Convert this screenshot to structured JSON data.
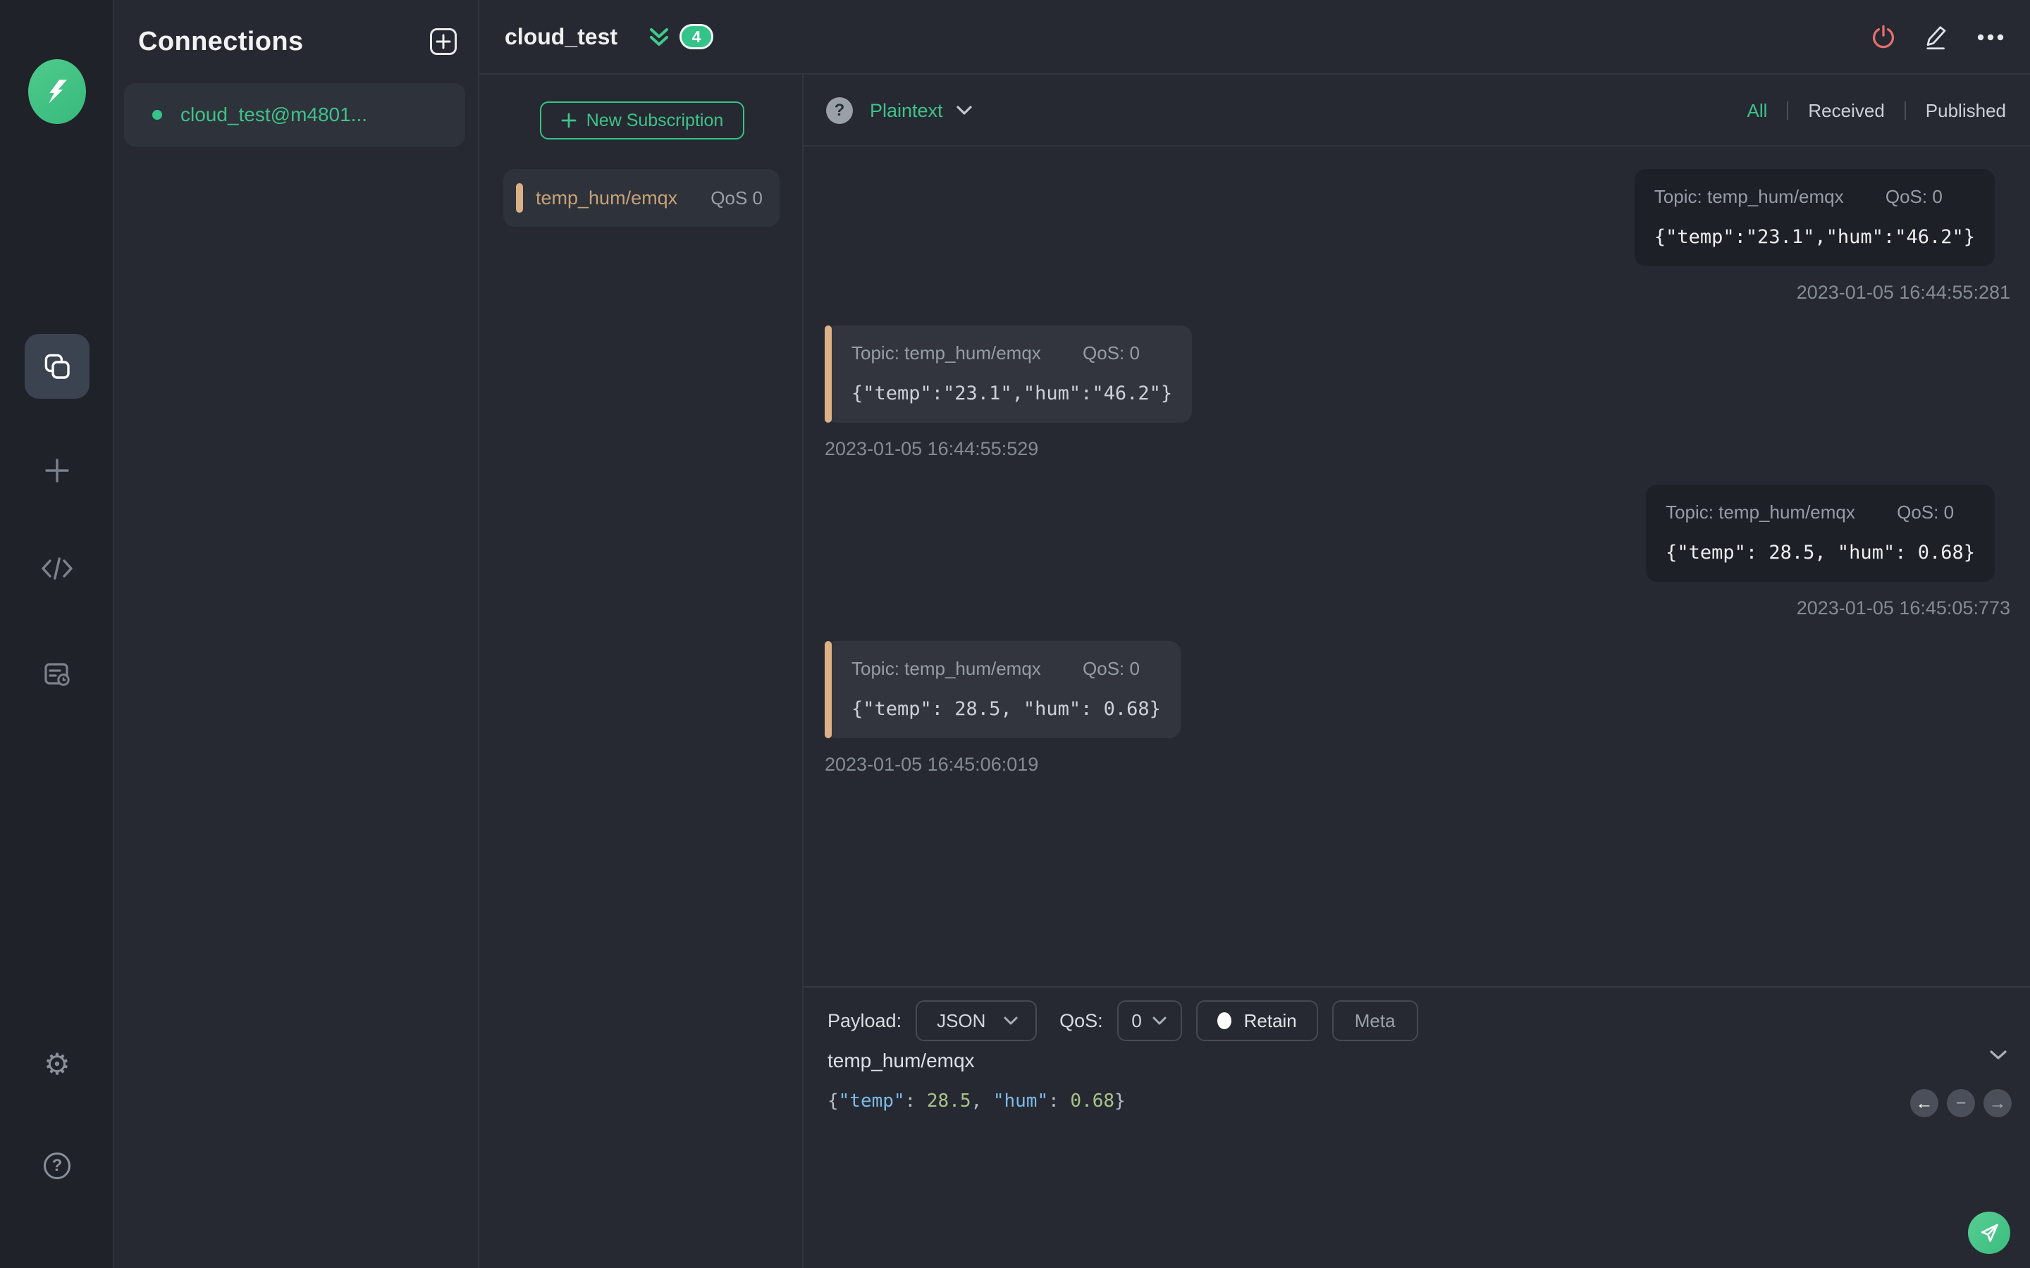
{
  "app": {
    "accent_green": "#34c388",
    "accent_tan": "#d0a97e",
    "danger_red": "#e36f6f",
    "syntax": {
      "key": "#7db9e8",
      "number": "#a9c289",
      "punctuation": "#b6bcc4"
    }
  },
  "glyphs": {
    "help": "?",
    "gear": "⚙",
    "prev_arrow": "←",
    "collapse_minus": "−",
    "next_arrow": "→"
  },
  "connections": {
    "title": "Connections",
    "items": [
      {
        "name": "cloud_test@m4801...",
        "selected": true,
        "status_color": "#34c388"
      }
    ]
  },
  "subscriptions": {
    "connection_name": "cloud_test",
    "badge_count": "4",
    "new_subscription_label": "New Subscription",
    "items": [
      {
        "topic": "temp_hum/emqx",
        "qos": "QoS 0"
      }
    ]
  },
  "toolbar": {
    "format": "Plaintext",
    "filters": {
      "all": "All",
      "received": "Received",
      "published": "Published"
    }
  },
  "messages": [
    {
      "type": "published",
      "meta_topic": "Topic: temp_hum/emqx",
      "meta_qos": "QoS: 0",
      "payload": "{\"temp\":\"23.1\",\"hum\":\"46.2\"}",
      "time": "2023-01-05 16:44:55:281"
    },
    {
      "type": "received",
      "meta_topic": "Topic: temp_hum/emqx",
      "meta_qos": "QoS: 0",
      "payload": "{\"temp\":\"23.1\",\"hum\":\"46.2\"}",
      "time": "2023-01-05 16:44:55:529"
    },
    {
      "type": "published",
      "meta_topic": "Topic: temp_hum/emqx",
      "meta_qos": "QoS: 0",
      "payload": "{\"temp\": 28.5, \"hum\": 0.68}",
      "time": "2023-01-05 16:45:05:773"
    },
    {
      "type": "received",
      "meta_topic": "Topic: temp_hum/emqx",
      "meta_qos": "QoS: 0",
      "payload": "{\"temp\": 28.5, \"hum\": 0.68}",
      "time": "2023-01-05 16:45:06:019"
    }
  ],
  "publish": {
    "payload_label": "Payload:",
    "payload_format": "JSON",
    "qos_label": "QoS:",
    "qos_value": "0",
    "retain_label": "Retain",
    "meta_label": "Meta",
    "topic": "temp_hum/emqx",
    "payload_tokens": [
      {
        "text": "{",
        "type": "punctuation"
      },
      {
        "text": "\"temp\"",
        "type": "key"
      },
      {
        "text": ": ",
        "type": "punctuation"
      },
      {
        "text": "28.5",
        "type": "number"
      },
      {
        "text": ", ",
        "type": "punctuation"
      },
      {
        "text": "\"hum\"",
        "type": "key"
      },
      {
        "text": ": ",
        "type": "punctuation"
      },
      {
        "text": "0.68",
        "type": "number"
      },
      {
        "text": "}",
        "type": "punctuation"
      }
    ]
  }
}
